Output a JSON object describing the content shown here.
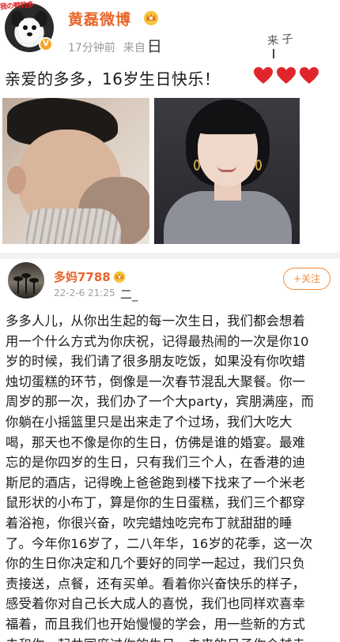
{
  "post1": {
    "avatar_scribble": "我の鸭钓多",
    "author": "黄磊微博",
    "time": "17分钟前",
    "source_prefix": "来自",
    "source_char": "日",
    "handwritten_note": "来 子",
    "text": "亲爱的多多，16岁生日快乐！",
    "hearts": [
      "heart",
      "heart",
      "heart"
    ],
    "colors": {
      "name": "#e8652a",
      "heart": "#e0262c",
      "badge": "#f5a623"
    }
  },
  "post2": {
    "author": "多妈7788",
    "time": "22-2-6 21:25",
    "time_mark": "二_",
    "follow_label": "+关注",
    "body_lines": [
      "多多人儿，从你出生起的每一次生日，我们都会想着",
      "用一个什么方式为你庆祝，记得最热闹的一次是你10",
      "岁的时候，我们请了很多朋友吃饭，如果没有你吹蜡",
      "烛切蛋糕的环节，倒像是一次春节混乱大聚餐。你一",
      "周岁的那一次，我们办了一个大party，宾朋满座，而",
      "你躺在小摇篮里只是出来走了个过场，我们大吃大",
      "喝，那天也不像是你的生日，仿佛是谁的婚宴。最难",
      "忘的是你四岁的生日，只有我们三个人，在香港的迪",
      "斯尼的酒店，记得晚上爸爸跑到楼下找来了一个米老",
      "鼠形状的小布丁，算是你的生日蛋糕，我们三个都穿",
      "着浴袍，你很兴奋，吹完蜡烛吃完布丁就甜甜的睡",
      "了。今年你16岁了，二八年华，16岁的花季，这一次",
      "你的生日你决定和几个要好的同学一起过，我们只负",
      "责接送，点餐，还有买单。看着你兴奋快乐的样子，",
      "感受着你对自己长大成人的喜悦，我们也同样欢喜幸",
      "福着，而且我们也开始慢慢的学会，用一些新的方式",
      "去和你一起共同度过你的生日，未来的日子你会越走"
    ],
    "colors": {
      "name": "#e8652a",
      "follow": "#f28b3a"
    }
  }
}
